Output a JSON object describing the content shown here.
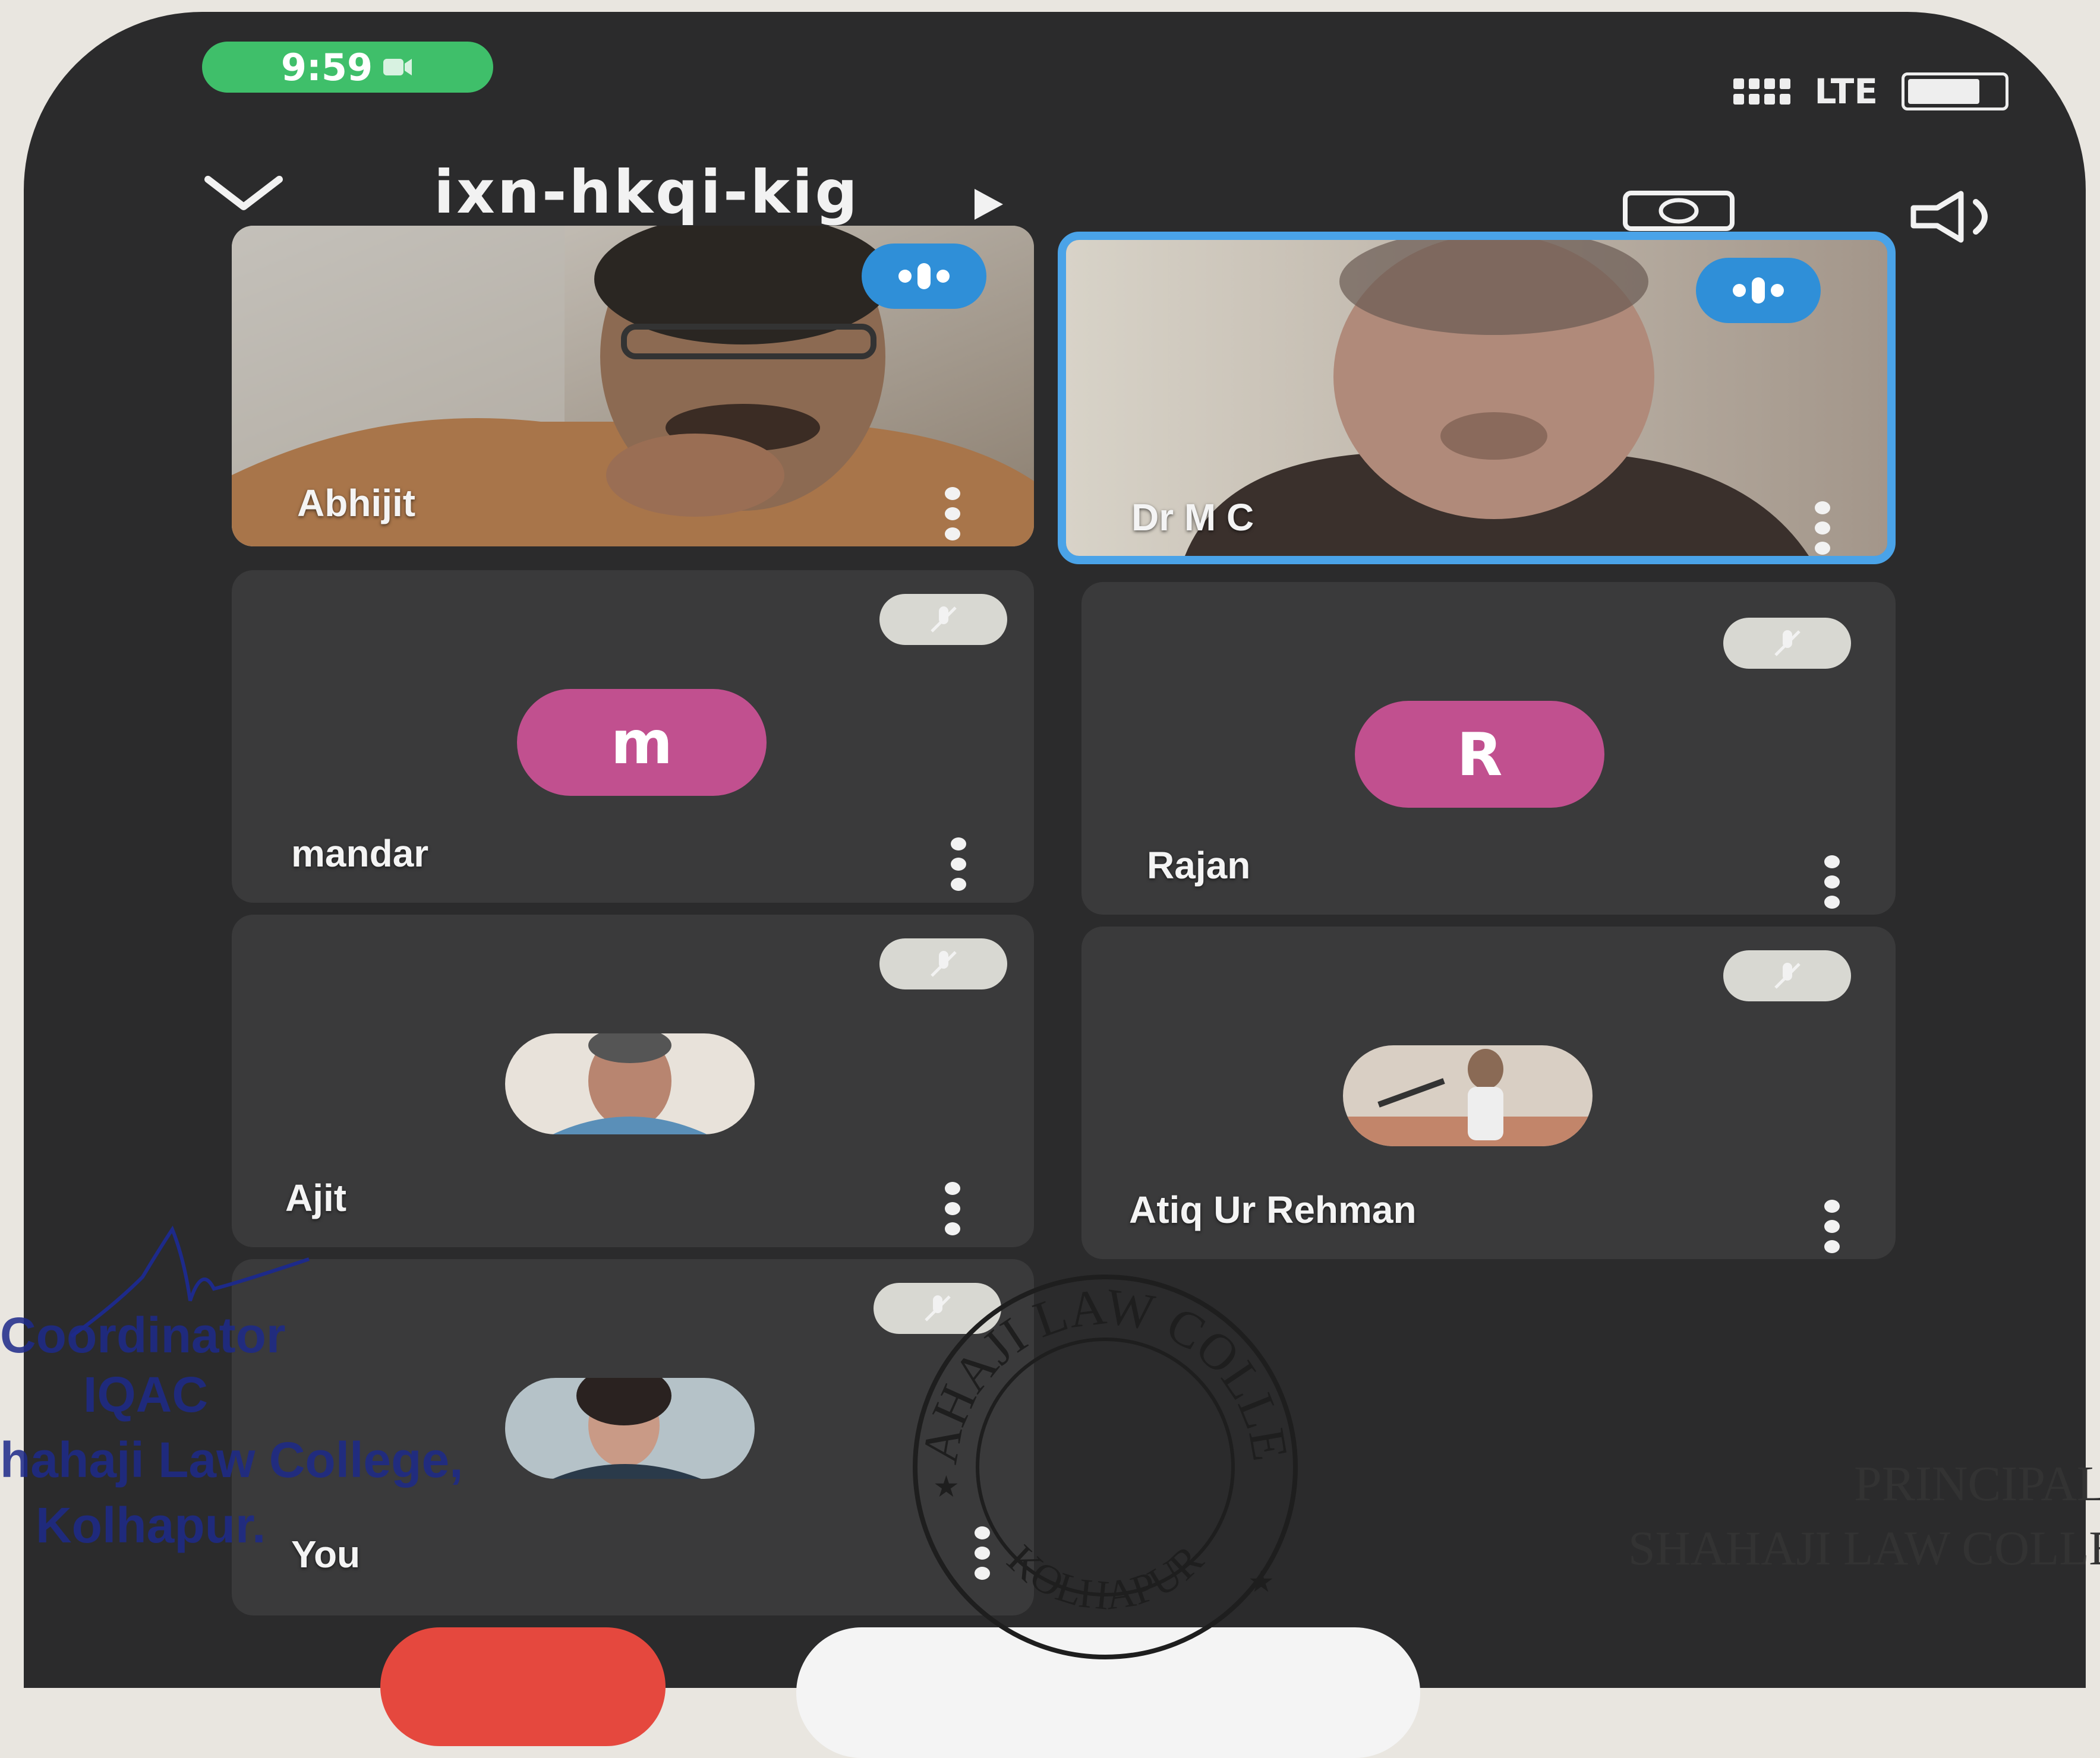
{
  "status_bar": {
    "time": "9:59",
    "network": "LTE"
  },
  "header": {
    "meeting_code": "ixn-hkqi-kig"
  },
  "icons": {
    "collapse": "chevron-down-icon",
    "switch_camera": "switch-camera-icon",
    "speaker": "speaker-icon",
    "more": "more-vertical-icon",
    "mic_off": "mic-off-icon",
    "speaking": "speaking-indicator-icon"
  },
  "participants": [
    {
      "name": "Abhijit",
      "type": "video",
      "speaking": true
    },
    {
      "name": "Dr M C",
      "type": "video",
      "speaking": true,
      "active": true
    },
    {
      "name": "mandar",
      "type": "initial",
      "initial": "m",
      "muted": true
    },
    {
      "name": "Rajan",
      "type": "initial",
      "initial": "R",
      "muted": true
    },
    {
      "name": "Ajit",
      "type": "photo",
      "muted": true
    },
    {
      "name": "Atiq Ur Rehman",
      "type": "photo",
      "muted": true
    },
    {
      "name": "You",
      "type": "photo",
      "muted": true
    }
  ],
  "overlay": {
    "signature_lines": [
      "Coordinator",
      "IQAC",
      "hahaji Law College,",
      "Kolhapur."
    ],
    "seal_text": "SHAHAJI LAW COLLEGE",
    "seal_bottom": "KOLHAPUR",
    "principal_lines": [
      "PRINCIPAL",
      "SHAHAJI LAW COLLEGE"
    ]
  },
  "colors": {
    "background": "#2b2b2c",
    "active_border": "#4aa3e8",
    "speaking_badge": "#2f8fd8",
    "avatar_pink": "#c1508f",
    "end_call": "#e5483e",
    "status_pill": "#3fbf6a"
  }
}
